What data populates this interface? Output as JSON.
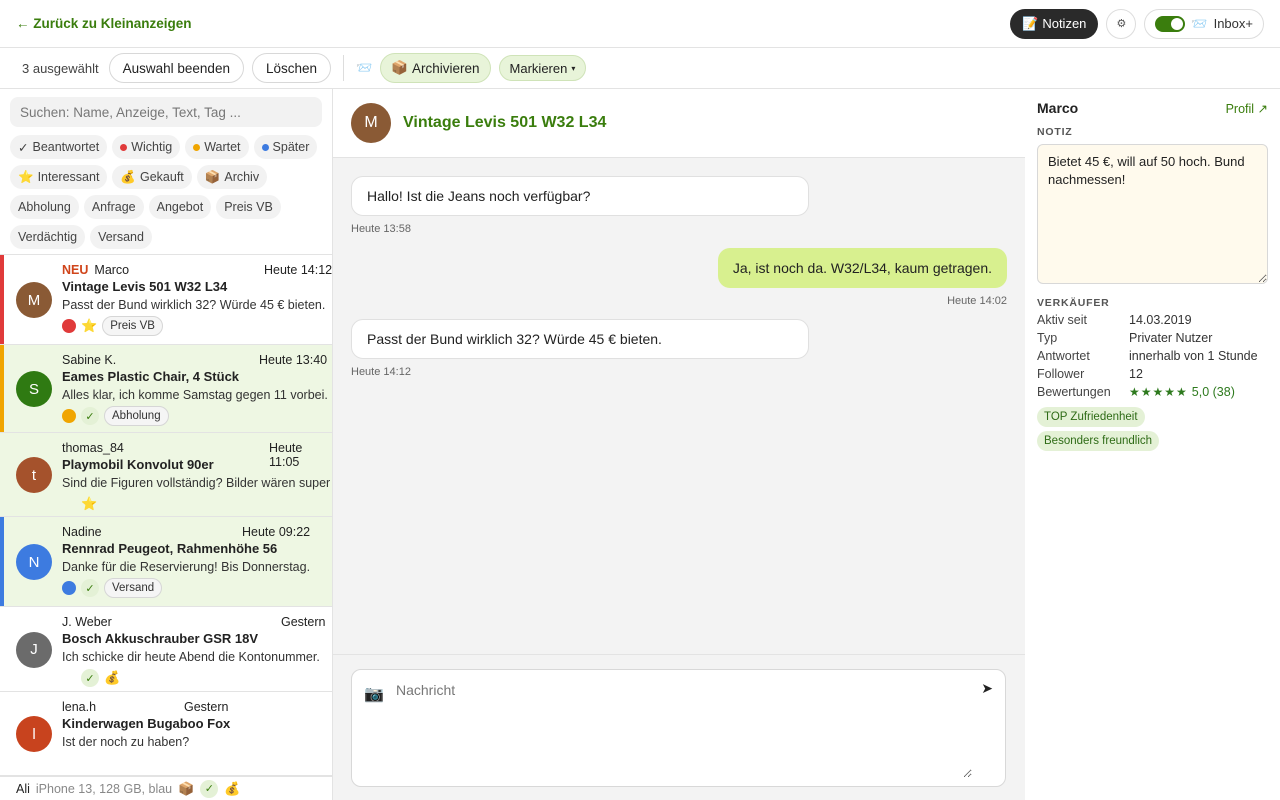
{
  "topbar": {
    "back_label": "← Zurück zu Kleinanzeigen",
    "notes_icon": "📝",
    "notes_label": "Notizen",
    "gear_icon": "⚙",
    "inbox_icon": "📨",
    "inbox_label": "Inbox+"
  },
  "actionbar": {
    "selected_count": "3 ausgewählt",
    "end_selection": "Auswahl beenden",
    "delete": "Löschen",
    "inbox_icon": "📨",
    "archive_icon": "📦",
    "archive": "Archivieren",
    "mark": "Markieren",
    "mark_caret": "▾"
  },
  "sidebar": {
    "search_placeholder": "Suchen: Name, Anzeige, Text, Tag ...",
    "filters": [
      {
        "icon": "✓",
        "label": "Beantwortet"
      },
      {
        "dot": "#e03a3a",
        "label": "Wichtig"
      },
      {
        "dot": "#f0a500",
        "label": "Wartet"
      },
      {
        "dot": "#3d7be0",
        "label": "Später"
      },
      {
        "icon": "⭐",
        "label": "Interessant"
      },
      {
        "icon": "💰",
        "label": "Gekauft"
      },
      {
        "icon": "📦",
        "label": "Archiv"
      },
      {
        "label": "Abholung"
      },
      {
        "label": "Anfrage"
      },
      {
        "label": "Angebot"
      },
      {
        "label": "Preis VB"
      },
      {
        "label": "Verdächtig"
      },
      {
        "label": "Versand"
      }
    ],
    "conversations": [
      {
        "new": "NEU",
        "name": "Marco",
        "time": "Heute 14:12",
        "title": "Vintage Levis 501 W32 L34",
        "preview": "Passt der Bund wirklich 32? Würde 45 € bieten.",
        "avatar": "M",
        "avatar_color": "#8a5a35",
        "bar": "#e03a3a",
        "tags": [
          "Preis VB"
        ]
      },
      {
        "name": "Sabine K.",
        "time": "Heute 13:40",
        "title": "Eames Plastic Chair, 4 Stück",
        "preview": "Alles klar, ich komme Samstag gegen 11 vorbei.",
        "avatar": "S",
        "avatar_color": "#2f7a12",
        "bar": "#f0a500",
        "tags": [
          "Abholung"
        ]
      },
      {
        "name": "thomas_84",
        "time": "Heute 11:05",
        "title": "Playmobil Konvolut 90er",
        "preview": "Sind die Figuren vollständig? Bilder wären super",
        "avatar": "t",
        "avatar_color": "#a5522c",
        "tags": []
      },
      {
        "name": "Nadine",
        "time": "Heute 09:22",
        "title": "Rennrad Peugeot, Rahmenhöhe 56",
        "preview": "Danke für die Reservierung! Bis Donnerstag.",
        "avatar": "N",
        "avatar_color": "#3d7be0",
        "bar": "#3d7be0",
        "tags": [
          "Versand"
        ]
      },
      {
        "name": "J. Weber",
        "time": "Gestern",
        "title": "Bosch Akkuschrauber GSR 18V",
        "preview": "Ich schicke dir heute Abend die Kontonummer.",
        "avatar": "J",
        "avatar_color": "#6b6b6b",
        "tags": []
      },
      {
        "name": "lena.h",
        "time": "Gestern",
        "title": "Kinderwagen Bugaboo Fox",
        "preview": "Ist der noch zu haben?",
        "avatar": "l",
        "avatar_color": "#c8431e",
        "tags": []
      }
    ],
    "partial_row": {
      "name": "Ali",
      "preview": "iPhone 13, 128 GB, blau"
    }
  },
  "chat": {
    "avatar": "M",
    "title": "Vintage Levis 501 W32 L34",
    "messages": [
      {
        "text": "Hallo! Ist die Jeans noch verfügbar?",
        "time": "Heute 13:58",
        "dir": "in"
      },
      {
        "text": "Ja, ist noch da. W32/L34, kaum getragen.",
        "time": "Heute 14:02",
        "dir": "out"
      },
      {
        "text": "Passt der Bund wirklich 32? Würde 45 € bieten.",
        "time": "Heute 14:12",
        "dir": "in"
      }
    ],
    "composer_placeholder": "Nachricht",
    "camera_icon": "📷",
    "send_icon": "➤"
  },
  "right": {
    "name": "Marco",
    "profile_link": "Profil ↗",
    "note_label": "NOTIZ",
    "note_text": "Bietet 45 €, will auf 50 hoch. Bund nachmessen!",
    "seller_label": "VERKÄUFER",
    "facts": [
      {
        "k": "Aktiv seit",
        "v": "14.03.2019"
      },
      {
        "k": "Typ",
        "v": "Privater Nutzer"
      },
      {
        "k": "Antwortet",
        "v": "innerhalb von 1 Stunde"
      },
      {
        "k": "Follower",
        "v": "12"
      }
    ],
    "ratings_label": "Bewertungen",
    "stars": "★★★★★",
    "rating_value": "5,0 (38)",
    "rating_score": 5.0,
    "badges": [
      "TOP Zufriedenheit",
      "Besonders freundlich"
    ]
  },
  "colors": {
    "accent": "#3a7d0d",
    "selected_bg": "#eef7e3",
    "sent_bubble": "#d8f08f"
  }
}
